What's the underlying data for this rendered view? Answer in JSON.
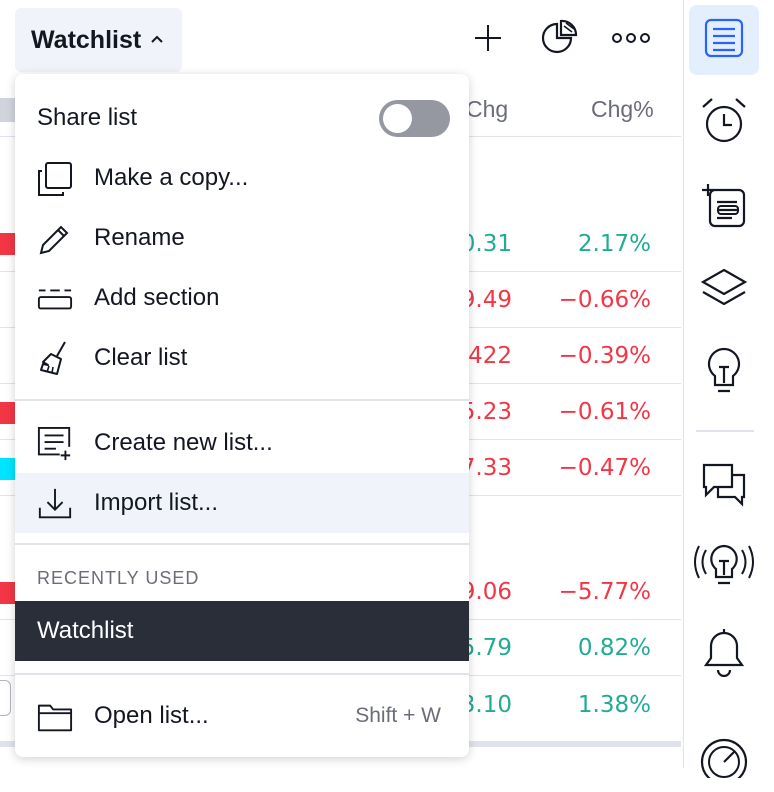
{
  "header": {
    "watchlist_label": "Watchlist"
  },
  "table": {
    "col_chg": "Chg",
    "col_chgp": "Chg%",
    "rows": [
      {
        "chg": "0.31",
        "chgp": "2.17%"
      },
      {
        "chg": "9.49",
        "chgp": "−0.66%"
      },
      {
        "chg": "422",
        "chgp": "−0.39%"
      },
      {
        "chg": "5.23",
        "chgp": "−0.61%"
      },
      {
        "chg": "7.33",
        "chgp": "−0.47%"
      },
      {
        "chg": "9.06",
        "chgp": "−5.77%"
      },
      {
        "chg": "5.79",
        "chgp": "0.82%"
      },
      {
        "chg": "3.10",
        "chgp": "1.38%"
      }
    ]
  },
  "menu": {
    "share_list": "Share list",
    "share_enabled": false,
    "make_copy": "Make a copy...",
    "rename": "Rename",
    "add_section": "Add section",
    "clear_list": "Clear list",
    "create_new": "Create new list...",
    "import_list": "Import list...",
    "recently_used_header": "RECENTLY USED",
    "recent_item": "Watchlist",
    "open_list": "Open list...",
    "open_list_shortcut": "Shift + W"
  },
  "colors": {
    "positive": "#22ab94",
    "negative": "#f23645",
    "accent": "#2962ff",
    "selected_bg": "#2a2e39"
  },
  "toolbar_icons": [
    "watchlist-icon",
    "alarm-clock-icon",
    "news-add-icon",
    "layers-icon",
    "lightbulb-icon",
    "chat-icon",
    "ideas-stream-icon",
    "bell-icon",
    "speedometer-icon"
  ]
}
